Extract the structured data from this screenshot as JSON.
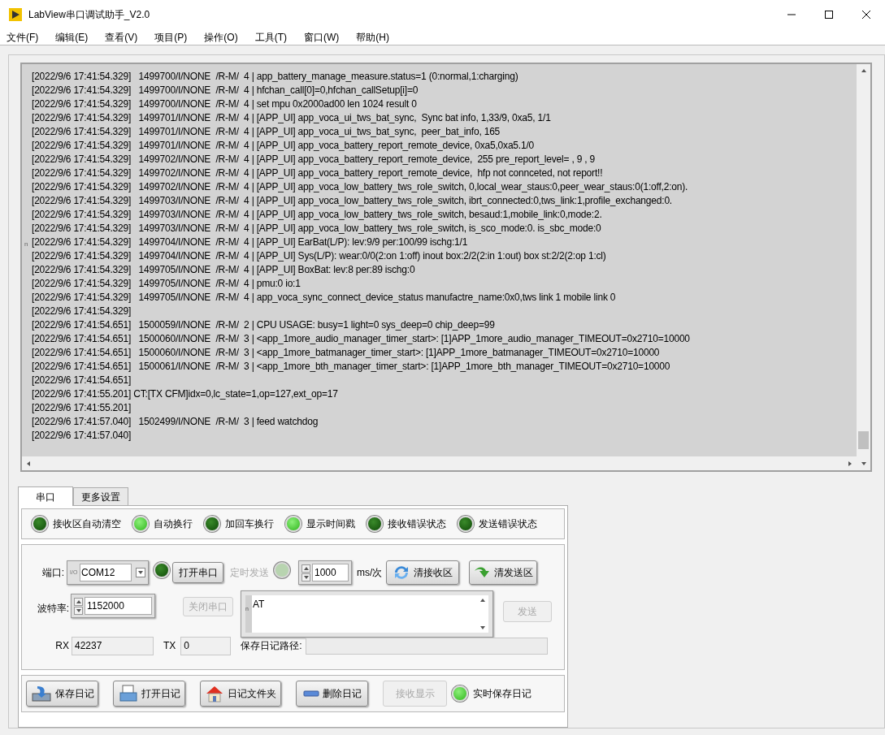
{
  "window": {
    "title": "LabView串口调试助手_V2.0"
  },
  "menu": [
    "文件(F)",
    "编辑(E)",
    "查看(V)",
    "项目(P)",
    "操作(O)",
    "工具(T)",
    "窗口(W)",
    "帮助(H)"
  ],
  "log": {
    "side_mark": "n",
    "lines": [
      "[2022/9/6 17:41:54.329]   1499700/I/NONE  /R-M/  4 | app_battery_manage_measure.status=1 (0:normal,1:charging)",
      "[2022/9/6 17:41:54.329]   1499700/I/NONE  /R-M/  4 | hfchan_call[0]=0,hfchan_callSetup[i]=0",
      "[2022/9/6 17:41:54.329]   1499700/I/NONE  /R-M/  4 | set mpu 0x2000ad00 len 1024 result 0",
      "[2022/9/6 17:41:54.329]   1499701/I/NONE  /R-M/  4 | [APP_UI] app_voca_ui_tws_bat_sync,  Sync bat info, 1,33/9, 0xa5, 1/1",
      "[2022/9/6 17:41:54.329]   1499701/I/NONE  /R-M/  4 | [APP_UI] app_voca_ui_tws_bat_sync,  peer_bat_info, 165",
      "[2022/9/6 17:41:54.329]   1499701/I/NONE  /R-M/  4 | [APP_UI] app_voca_battery_report_remote_device, 0xa5,0xa5.1/0",
      "[2022/9/6 17:41:54.329]   1499702/I/NONE  /R-M/  4 | [APP_UI] app_voca_battery_report_remote_device,  255 pre_report_level= , 9 , 9",
      "[2022/9/6 17:41:54.329]   1499702/I/NONE  /R-M/  4 | [APP_UI] app_voca_battery_report_remote_device,  hfp not connceted, not report!!",
      "[2022/9/6 17:41:54.329]   1499702/I/NONE  /R-M/  4 | [APP_UI] app_voca_low_battery_tws_role_switch, 0,local_wear_staus:0,peer_wear_staus:0(1:off,2:on).",
      "[2022/9/6 17:41:54.329]   1499703/I/NONE  /R-M/  4 | [APP_UI] app_voca_low_battery_tws_role_switch, ibrt_connected:0,tws_link:1,profile_exchanged:0.",
      "[2022/9/6 17:41:54.329]   1499703/I/NONE  /R-M/  4 | [APP_UI] app_voca_low_battery_tws_role_switch, besaud:1,mobile_link:0,mode:2.",
      "[2022/9/6 17:41:54.329]   1499703/I/NONE  /R-M/  4 | [APP_UI] app_voca_low_battery_tws_role_switch, is_sco_mode:0. is_sbc_mode:0",
      "[2022/9/6 17:41:54.329]   1499704/I/NONE  /R-M/  4 | [APP_UI] EarBat(L/P): lev:9/9 per:100/99 ischg:1/1",
      "[2022/9/6 17:41:54.329]   1499704/I/NONE  /R-M/  4 | [APP_UI] Sys(L/P): wear:0/0(2:on 1:off) inout box:2/2(2:in 1:out) box st:2/2(2:op 1:cl)",
      "[2022/9/6 17:41:54.329]   1499705/I/NONE  /R-M/  4 | [APP_UI] BoxBat: lev:8 per:89 ischg:0",
      "[2022/9/6 17:41:54.329]   1499705/I/NONE  /R-M/  4 | pmu:0 io:1",
      "[2022/9/6 17:41:54.329]   1499705/I/NONE  /R-M/  4 | app_voca_sync_connect_device_status manufactre_name:0x0,tws link 1 mobile link 0",
      "[2022/9/6 17:41:54.329]",
      "[2022/9/6 17:41:54.651]   1500059/I/NONE  /R-M/  2 | CPU USAGE: busy=1 light=0 sys_deep=0 chip_deep=99",
      "[2022/9/6 17:41:54.651]   1500060/I/NONE  /R-M/  3 | <app_1more_audio_manager_timer_start>: [1]APP_1more_audio_manager_TIMEOUT=0x2710=10000",
      "[2022/9/6 17:41:54.651]   1500060/I/NONE  /R-M/  3 | <app_1more_batmanager_timer_start>: [1]APP_1more_batmanager_TIMEOUT=0x2710=10000",
      "[2022/9/6 17:41:54.651]   1500061/I/NONE  /R-M/  3 | <app_1more_bth_manager_timer_start>: [1]APP_1more_bth_manager_TIMEOUT=0x2710=10000",
      "[2022/9/6 17:41:54.651]",
      "[2022/9/6 17:41:55.201] CT:[TX CFM]idx=0,lc_state=1,op=127,ext_op=17",
      "[2022/9/6 17:41:55.201]",
      "[2022/9/6 17:41:57.040]   1502499/I/NONE  /R-M/  3 | feed watchdog",
      "[2022/9/6 17:41:57.040]"
    ]
  },
  "tabs": [
    {
      "label": "串口",
      "selected": true
    },
    {
      "label": "更多设置",
      "selected": false
    }
  ],
  "indicators": [
    {
      "label": "接收区自动清空",
      "on": false
    },
    {
      "label": "自动换行",
      "on": true
    },
    {
      "label": "加回车换行",
      "on": false
    },
    {
      "label": "显示时间戳",
      "on": true
    },
    {
      "label": "接收错误状态",
      "on": false
    },
    {
      "label": "发送错误状态",
      "on": false
    }
  ],
  "serial": {
    "port": {
      "label": "端口:",
      "prefix": "I/O",
      "value": "COM12"
    },
    "port_led": {
      "on": false
    },
    "open_button": {
      "label": "打开串口",
      "disabled": false
    },
    "timed_send": {
      "label": "定时发送",
      "disabled": true
    },
    "interval": {
      "value": "1000",
      "unit": "ms/次"
    },
    "clear_receive": {
      "label": "清接收区"
    },
    "clear_send": {
      "label": "清发送区"
    },
    "baud": {
      "label": "波特率:",
      "value": "1152000"
    },
    "close_button": {
      "label": "关闭串口",
      "disabled": true
    },
    "send_text": {
      "mark": "n",
      "value": "AT"
    },
    "send_button": {
      "label": "发送",
      "disabled": true
    },
    "rx": {
      "label": "RX",
      "value": "42237"
    },
    "tx": {
      "label": "TX",
      "value": "0"
    },
    "log_path": {
      "label": "保存日记路径:"
    }
  },
  "actions": [
    {
      "kind": "save",
      "label": "保存日记",
      "disabled": false
    },
    {
      "kind": "open",
      "label": "打开日记",
      "disabled": false
    },
    {
      "kind": "folder",
      "label": "日记文件夹",
      "disabled": false
    },
    {
      "kind": "delete",
      "label": "删除日记",
      "disabled": false
    },
    {
      "kind": "plain",
      "label": "接收显示",
      "disabled": true
    }
  ],
  "realtime_save": {
    "label": "实时保存日记",
    "on": true
  }
}
